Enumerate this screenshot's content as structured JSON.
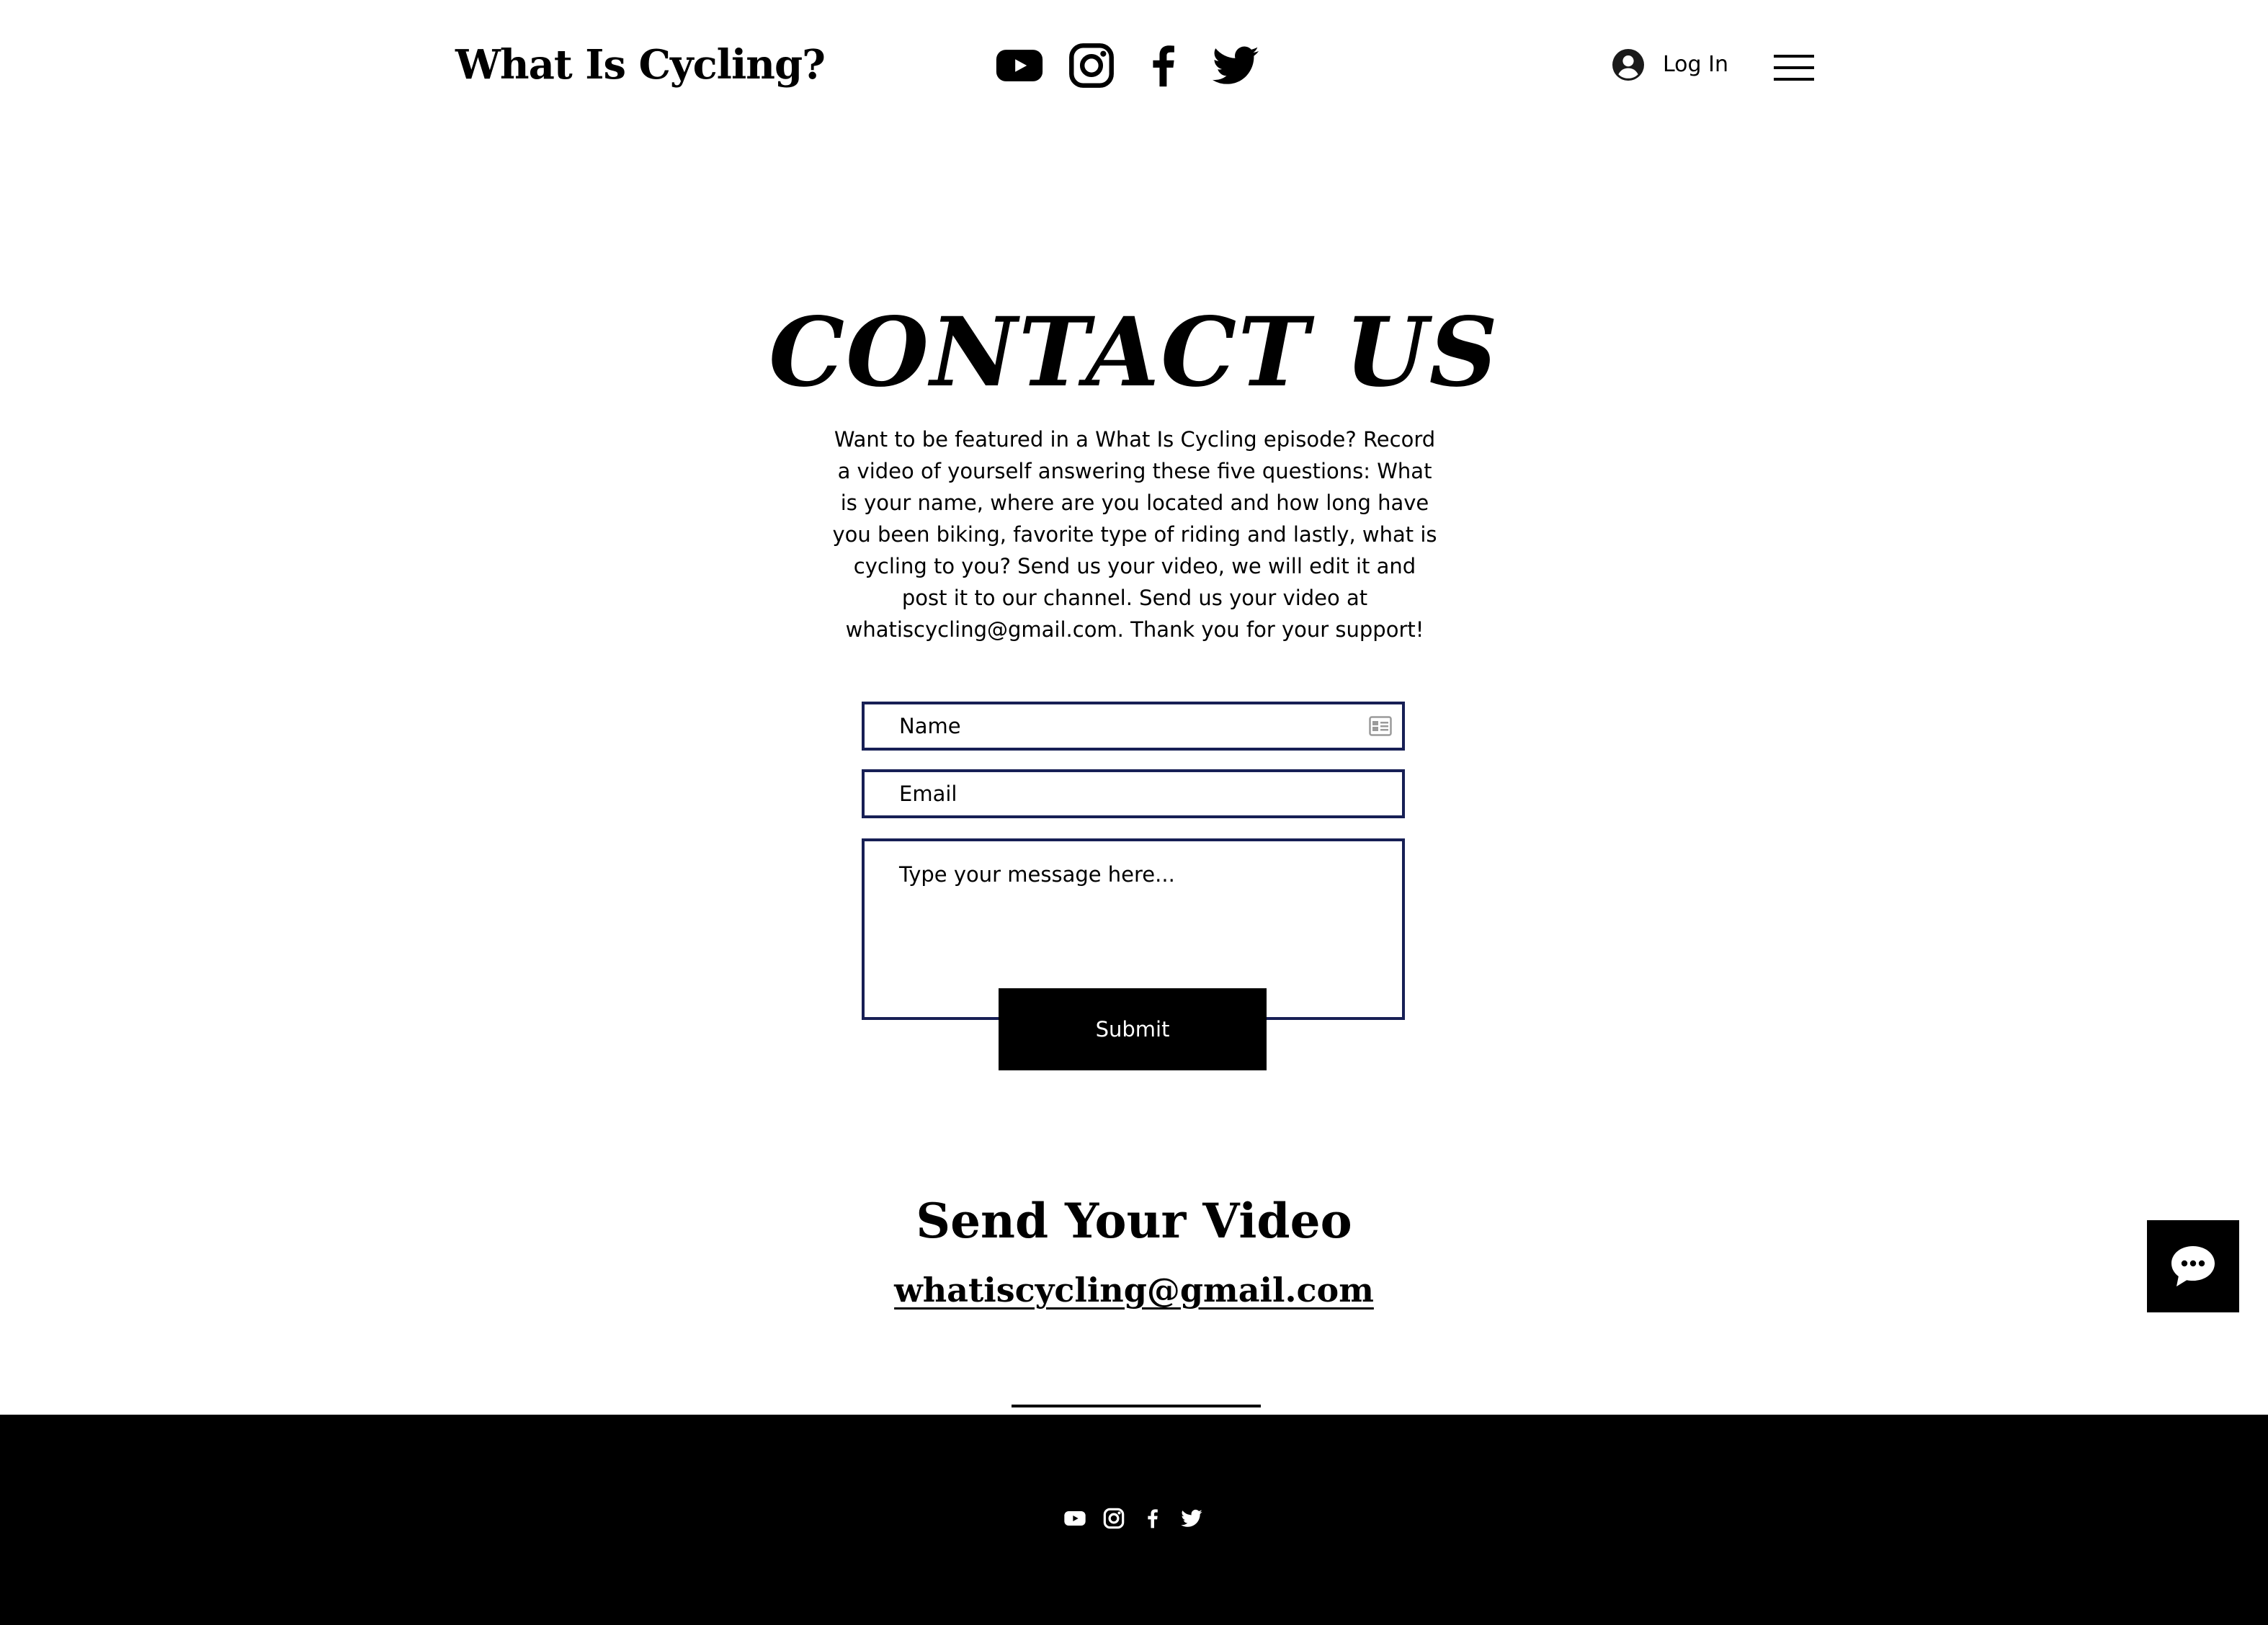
{
  "header": {
    "site_title": "What Is Cycling?",
    "social_icons": [
      "youtube-icon",
      "instagram-icon",
      "facebook-icon",
      "twitter-icon"
    ],
    "login_label": "Log In",
    "menu_icon": "hamburger-menu-icon"
  },
  "contact": {
    "heading": "CONTACT US",
    "intro": "Want to be featured in a What Is Cycling episode? Record a video of yourself answering these five questions: What is your name, where are you located and how long have you been biking, favorite type of riding and lastly, what is cycling to you? Send us your video, we will edit it and post it to our channel. Send us your video at whatiscycling@gmail.com. Thank you for your support!",
    "form": {
      "name_placeholder": "Name",
      "email_placeholder": "Email",
      "message_placeholder": "Type your message here...",
      "submit_label": "Submit",
      "border_color": "#171f55"
    }
  },
  "send_video": {
    "title": "Send Your Video",
    "email": "whatiscycling@gmail.com"
  },
  "footer": {
    "social_icons": [
      "youtube-icon",
      "instagram-icon",
      "facebook-icon",
      "twitter-icon"
    ],
    "background": "#000000"
  },
  "chat_widget": {
    "icon": "chat-bubble-icon"
  }
}
